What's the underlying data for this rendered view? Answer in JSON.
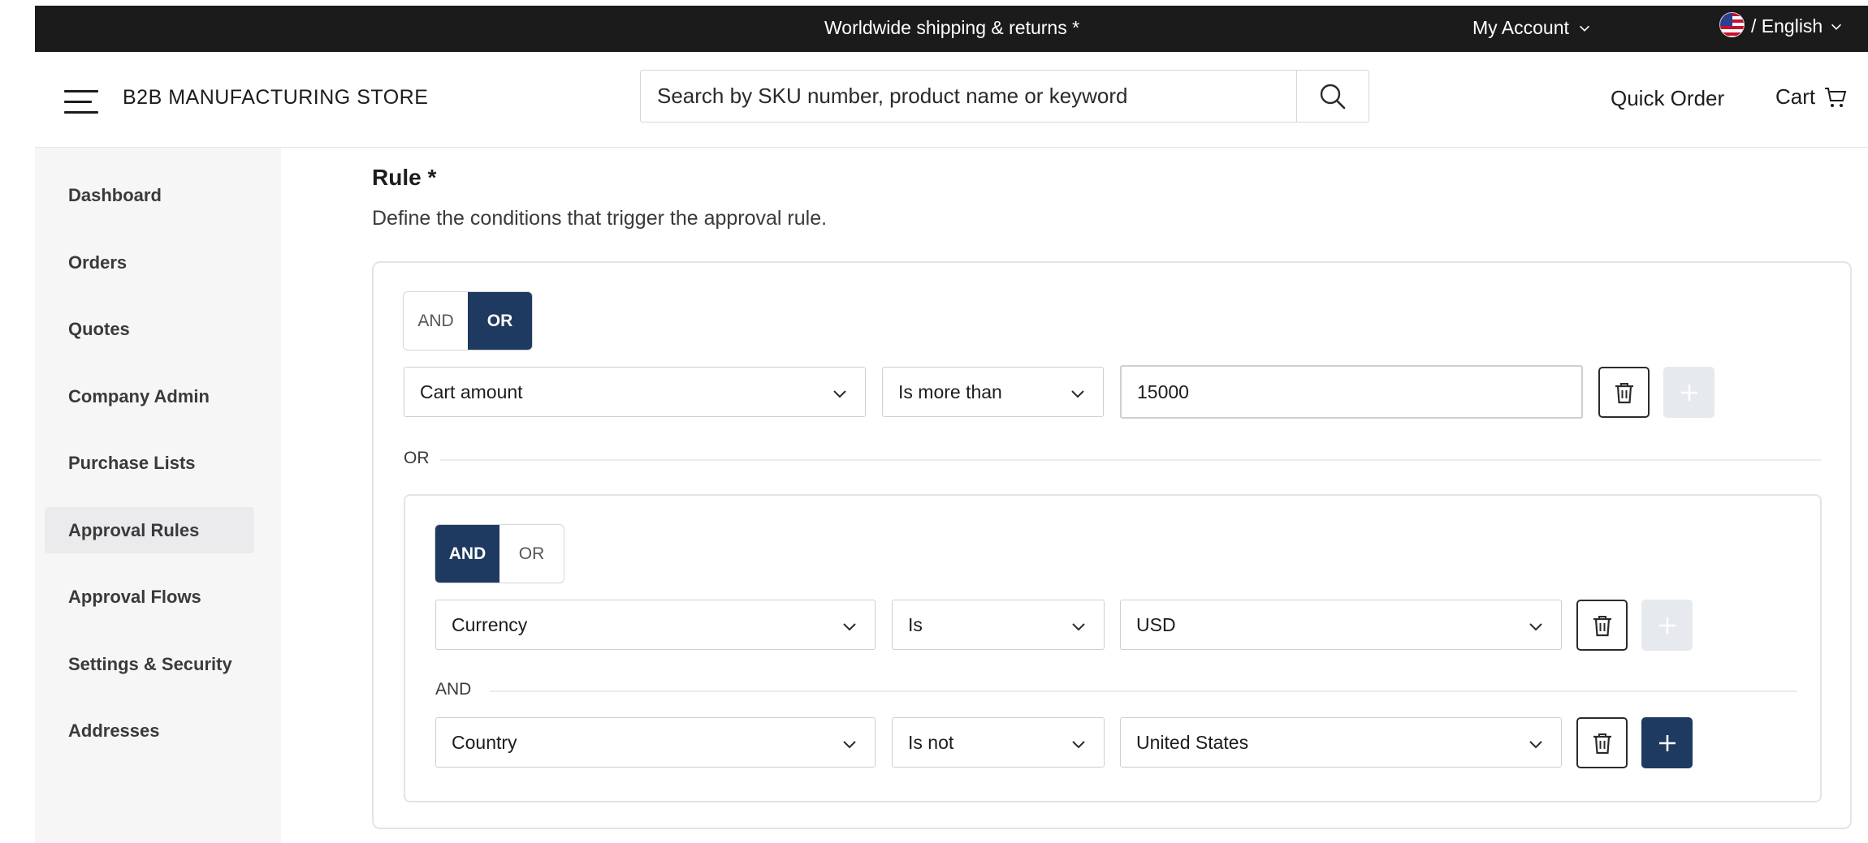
{
  "top_bar": {
    "promo": "Worldwide shipping & returns *",
    "account_label": "My Account",
    "language_label": "/ English"
  },
  "header": {
    "store_name": "B2B MANUFACTURING STORE",
    "search_placeholder": "Search by SKU number, product name or keyword",
    "quick_order": "Quick Order",
    "cart": "Cart"
  },
  "sidebar": {
    "items": [
      {
        "label": "Dashboard"
      },
      {
        "label": "Orders"
      },
      {
        "label": "Quotes"
      },
      {
        "label": "Company Admin"
      },
      {
        "label": "Purchase Lists"
      },
      {
        "label": "Approval Rules",
        "active": true
      },
      {
        "label": "Approval Flows"
      },
      {
        "label": "Settings & Security"
      },
      {
        "label": "Addresses"
      }
    ]
  },
  "rule": {
    "title": "Rule *",
    "description": "Define the conditions that trigger the approval rule.",
    "top_operator": {
      "options": [
        "AND",
        "OR"
      ],
      "selected": "OR"
    },
    "condition_1": {
      "field": "Cart amount",
      "operator": "Is more than",
      "value": "15000"
    },
    "separator_1": "OR",
    "group": {
      "operator": {
        "options": [
          "AND",
          "OR"
        ],
        "selected": "AND"
      },
      "condition_1": {
        "field": "Currency",
        "operator": "Is",
        "value": "USD"
      },
      "separator": "AND",
      "condition_2": {
        "field": "Country",
        "operator": "Is not",
        "value": "United States"
      }
    }
  },
  "colors": {
    "accent": "#1f3a60",
    "top_bar_bg": "#1b1b1b",
    "sidebar_bg": "#f6f6f7",
    "disabled_button": "#e6e9ee"
  },
  "icons": {
    "menu": "hamburger-icon",
    "search": "search-icon",
    "cart": "cart-icon",
    "trash": "trash-icon",
    "add": "plus-icon",
    "chevron": "chevron-down-icon",
    "flag": "us-flag-icon"
  }
}
